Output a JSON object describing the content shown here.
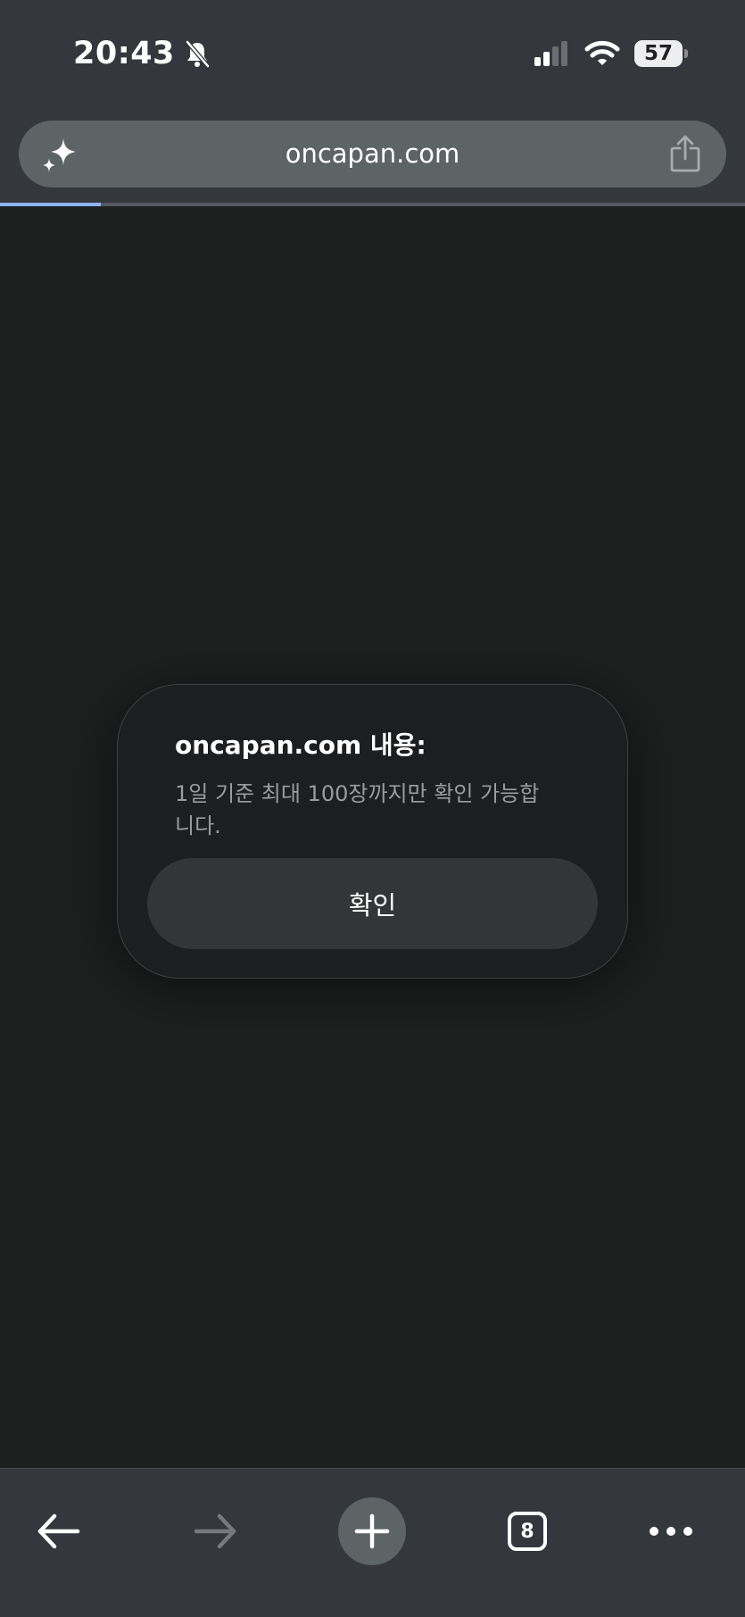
{
  "status_bar": {
    "time": "20:43",
    "battery_level": "57",
    "icons": [
      "bell-slash-icon",
      "signal-icon",
      "wifi-icon",
      "battery-icon"
    ]
  },
  "browser": {
    "url": "oncapan.com",
    "load_progress": 0.135,
    "icons": [
      "sparkle-icon",
      "share-icon"
    ]
  },
  "dialog": {
    "title": "oncapan.com 내용:",
    "message": "1일 기준 최대 100장까지만 확인 가능합니다.",
    "confirm_label": "확인"
  },
  "bottom_bar": {
    "tab_count": "8",
    "icons": [
      "back-arrow-icon",
      "forward-arrow-icon",
      "plus-icon",
      "tabs-icon",
      "more-icon"
    ]
  },
  "colors": {
    "toolbar": "#34373b",
    "content": "#1e1f1f",
    "progress": "#8ab4f8"
  }
}
